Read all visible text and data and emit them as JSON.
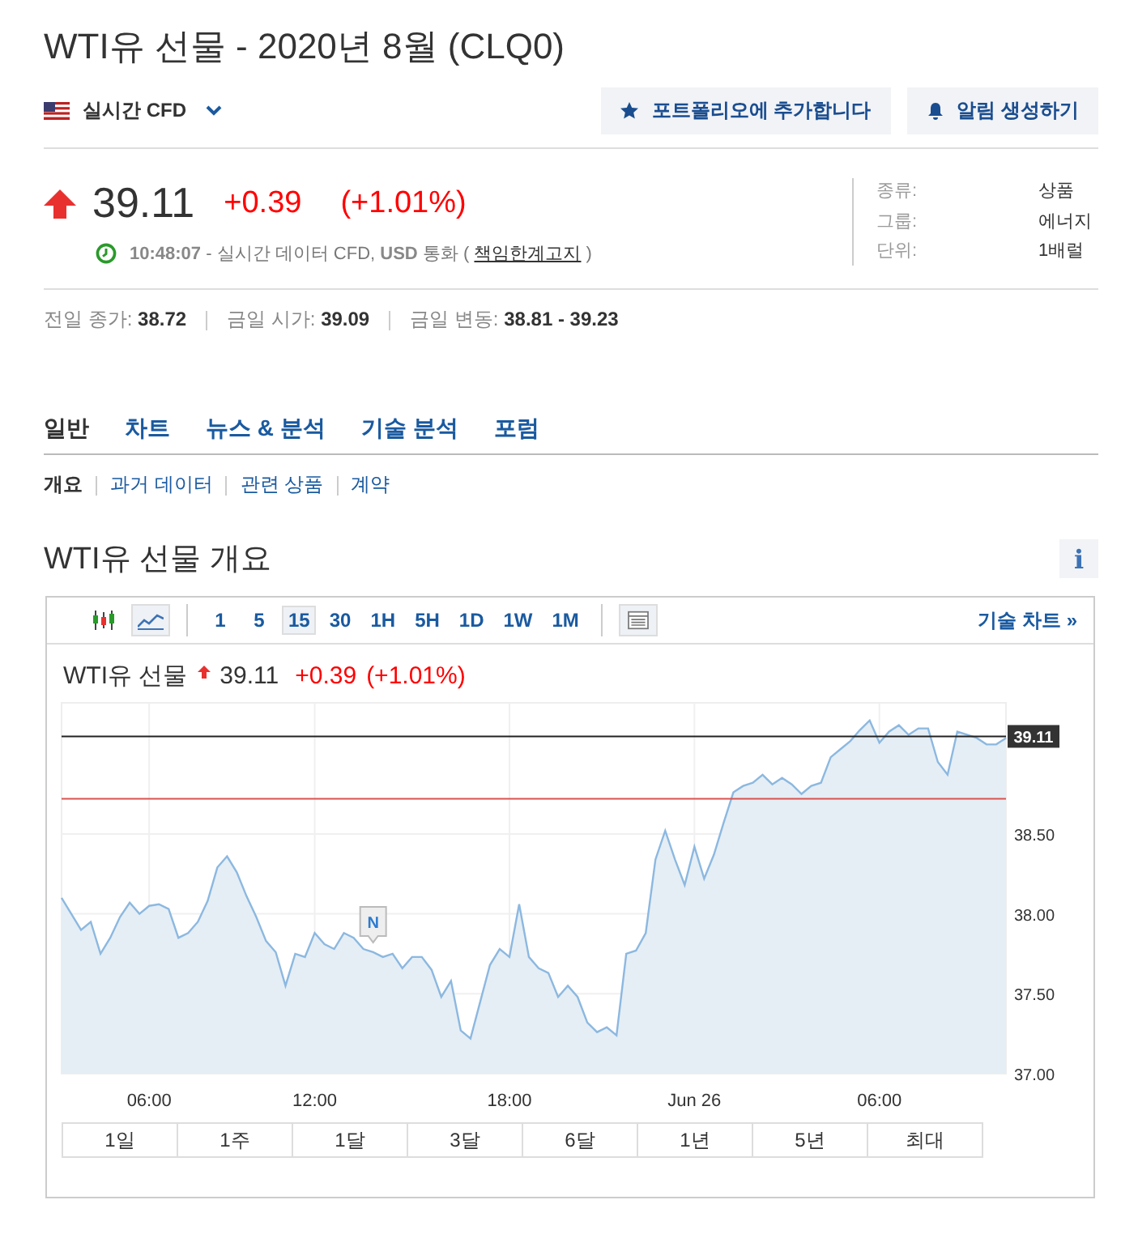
{
  "header": {
    "title": "WTI유 선물 - 2020년 8월 (CLQ0)",
    "market": "실시간 CFD",
    "buttons": [
      {
        "kind": "portfolio",
        "label": "포트폴리오에 추가합니다"
      },
      {
        "kind": "alert",
        "label": "알림 생성하기"
      }
    ]
  },
  "quote": {
    "price": "39.11",
    "change": "+0.39",
    "change_pct": "(+1.01%)",
    "info_text": "**10:48:07** - 실시간 데이터 CFD, **USD** 통화 (",
    "disclaimer_link": "책임한계고지",
    "info_end": ")"
  },
  "details": [
    {
      "label": "종류:",
      "value": "상품"
    },
    {
      "label": "그룹:",
      "value": "에너지"
    },
    {
      "label": "단위:",
      "value": "1배럴"
    }
  ],
  "stats": [
    {
      "label": "전일 종가:",
      "value": "38.72"
    },
    {
      "label": "금일 시가:",
      "value": "39.09"
    },
    {
      "label": "금일 변동:",
      "value": "38.81 - 39.23"
    }
  ],
  "tabs": [
    {
      "label": "일반",
      "selected": true
    },
    {
      "label": "차트",
      "selected": false
    },
    {
      "label": "뉴스 & 분석",
      "selected": false
    },
    {
      "label": "기술 분석",
      "selected": false
    },
    {
      "label": "포럼",
      "selected": false
    }
  ],
  "subtabs": [
    {
      "label": "개요",
      "selected": true
    },
    {
      "label": "과거 데이터",
      "selected": false
    },
    {
      "label": "관련 상품",
      "selected": false
    },
    {
      "label": "계약",
      "selected": false
    }
  ],
  "section": {
    "title": "WTI유 선물 개요",
    "info_button": "i"
  },
  "chart": {
    "toolbar": {
      "types": [
        {
          "kind": "candles",
          "selected": false
        },
        {
          "kind": "line",
          "selected": true
        }
      ],
      "intervals": [
        {
          "label": "1",
          "selected": false
        },
        {
          "label": "5",
          "selected": false
        },
        {
          "label": "15",
          "selected": true
        },
        {
          "label": "30",
          "selected": false
        },
        {
          "label": "1H",
          "selected": false
        },
        {
          "label": "5H",
          "selected": false
        },
        {
          "label": "1D",
          "selected": false
        },
        {
          "label": "1W",
          "selected": false
        },
        {
          "label": "1M",
          "selected": false
        }
      ],
      "technical_link": "기술 차트 »"
    },
    "legend": {
      "price": "39.11",
      "change": "+0.39",
      "change_pct": "(+1.01%)"
    },
    "chart_data": {
      "type": "area",
      "grid": true,
      "ylim": [
        37,
        39.32
      ],
      "categories": [
        null,
        null,
        null,
        null,
        null,
        null,
        null,
        null,
        null,
        "06:00",
        null,
        null,
        null,
        null,
        null,
        null,
        null,
        null,
        null,
        null,
        null,
        null,
        null,
        null,
        null,
        null,
        "12:00",
        null,
        null,
        null,
        null,
        null,
        null,
        null,
        null,
        null,
        null,
        null,
        null,
        null,
        null,
        null,
        null,
        null,
        null,
        null,
        "18:00",
        null,
        null,
        null,
        null,
        null,
        null,
        null,
        null,
        null,
        null,
        null,
        null,
        null,
        null,
        null,
        null,
        null,
        null,
        "Jun 26",
        null,
        null,
        null,
        null,
        null,
        null,
        null,
        null,
        null,
        null,
        null,
        null,
        null,
        null,
        null,
        null,
        null,
        null,
        "06:00",
        null,
        null,
        null,
        null,
        null,
        null,
        null,
        null,
        null,
        null,
        null,
        null,
        null
      ],
      "yticks": [
        {
          "value": 37,
          "label": "37.00"
        },
        {
          "value": 37.5,
          "label": "37.50"
        },
        {
          "value": 38,
          "label": "38.00"
        },
        {
          "value": 38.5,
          "label": "38.50"
        }
      ],
      "series": [
        {
          "name": "WTI유 선물",
          "color": "#8cb8e0",
          "values": [
            38.1,
            38.0,
            37.9,
            37.95,
            37.75,
            37.85,
            37.98,
            38.07,
            38.0,
            38.05,
            38.06,
            38.03,
            37.85,
            37.88,
            37.95,
            38.08,
            38.29,
            38.36,
            38.26,
            38.11,
            37.98,
            37.83,
            37.76,
            37.55,
            37.75,
            37.73,
            37.88,
            37.81,
            37.78,
            37.88,
            37.85,
            37.78,
            37.76,
            37.73,
            37.75,
            37.66,
            37.73,
            37.73,
            37.65,
            37.48,
            37.58,
            37.27,
            37.22,
            37.45,
            37.68,
            37.78,
            37.73,
            38.06,
            37.73,
            37.66,
            37.63,
            37.48,
            37.55,
            37.48,
            37.32,
            37.26,
            37.29,
            37.24,
            37.75,
            37.77,
            37.88,
            38.34,
            38.52,
            38.34,
            38.18,
            38.42,
            38.22,
            38.37,
            38.57,
            38.76,
            38.8,
            38.82,
            38.87,
            38.81,
            38.85,
            38.81,
            38.75,
            38.8,
            38.82,
            38.98,
            39.03,
            39.08,
            39.15,
            39.21,
            39.07,
            39.14,
            39.18,
            39.12,
            39.16,
            39.16,
            38.95,
            38.87,
            39.14,
            39.12,
            39.1,
            39.06,
            39.06,
            39.1
          ]
        }
      ],
      "ref_lines": [
        {
          "axis": "y",
          "value": 39.11,
          "label": "39.11",
          "color": "#222222"
        },
        {
          "axis": "y",
          "value": 38.72,
          "color": "#d9534f"
        }
      ]
    },
    "news_marker": {
      "label": "N"
    },
    "ranges": [
      "1일",
      "1주",
      "1달",
      "3달",
      "6달",
      "1년",
      "5년",
      "최대"
    ]
  }
}
